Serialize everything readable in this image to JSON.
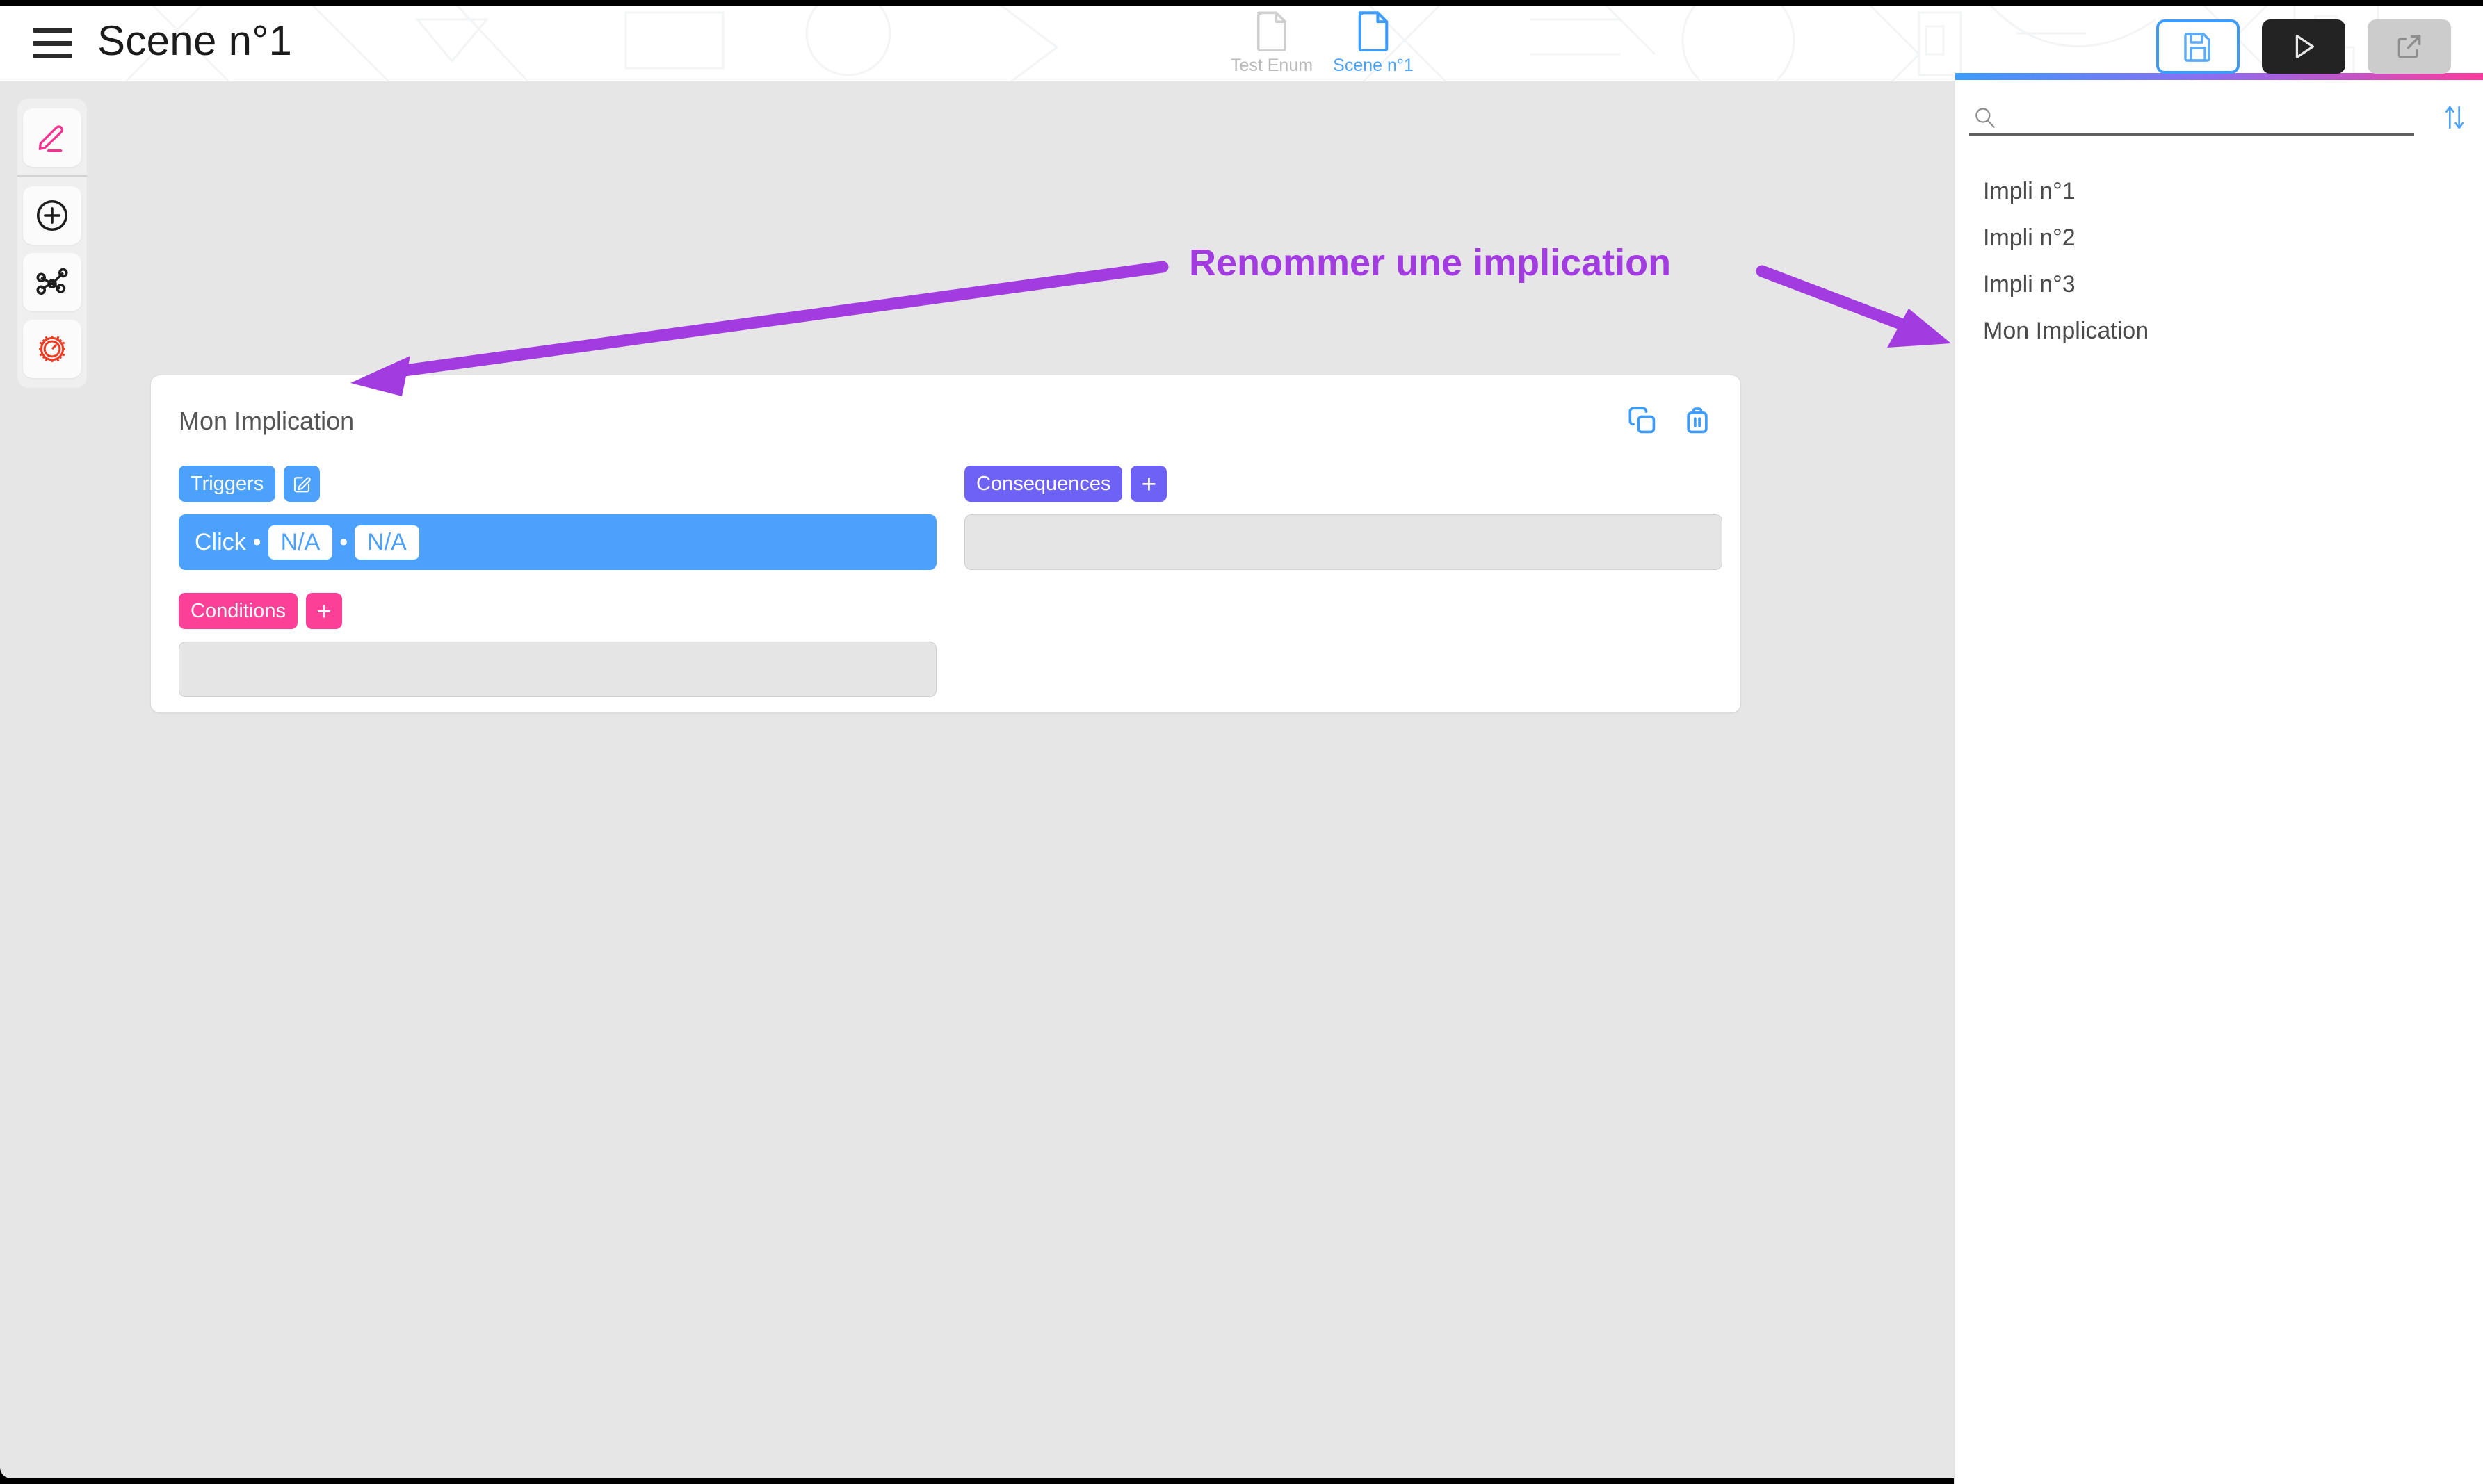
{
  "header": {
    "menu_icon": "hamburger-menu-icon",
    "title": "Scene n°1",
    "tabs": [
      {
        "label": "Test Enum",
        "icon": "document-icon",
        "active": false
      },
      {
        "label": "Scene n°1",
        "icon": "document-icon",
        "active": true
      }
    ],
    "actions": [
      {
        "name": "save-button",
        "icon": "floppy-disk-save-icon",
        "state": "outlined-active"
      },
      {
        "name": "play-button",
        "icon": "play-triangle-icon",
        "state": "dark"
      },
      {
        "name": "export-button",
        "icon": "external-link-icon",
        "state": "disabled"
      }
    ]
  },
  "tool_rail": {
    "tools": [
      {
        "name": "edit-pen-tool",
        "icon": "pen-icon",
        "color": "#f8338f"
      },
      {
        "name": "add-tool",
        "icon": "plus-circle-icon",
        "color": "#1d1d1d"
      },
      {
        "name": "graph-nodes-tool",
        "icon": "node-graph-icon",
        "color": "#1d1d1d"
      },
      {
        "name": "settings-gauge-tool",
        "icon": "gauge-gear-icon",
        "color": "#ef3b22"
      }
    ]
  },
  "card": {
    "title": "Mon Implication",
    "duplicate_icon": "copy-duplicate-icon",
    "delete_icon": "trash-bin-icon",
    "triggers": {
      "label": "Triggers",
      "action_icon": "edit-square-pen-icon",
      "item": {
        "name": "Click",
        "params": [
          "N/A",
          "N/A"
        ],
        "separator": "•"
      }
    },
    "consequences": {
      "label": "Consequences",
      "action_label": "+",
      "item": ""
    },
    "conditions": {
      "label": "Conditions",
      "action_label": "+",
      "item": ""
    }
  },
  "right_panel": {
    "search": {
      "value": "",
      "placeholder": "",
      "icon": "magnifier-search-icon"
    },
    "sort_icon": "sort-updown-arrows-icon",
    "items": [
      {
        "label": "Impli n°1"
      },
      {
        "label": "Impli n°2"
      },
      {
        "label": "Impli n°3"
      },
      {
        "label": "Mon Implication"
      }
    ]
  },
  "annotation": {
    "text": "Renommer une implication",
    "color": "#a33ce0"
  },
  "colors": {
    "trigger_blue": "#4ba1fb",
    "consequence_purple": "#6e62f6",
    "condition_pink": "#fc4098",
    "accent_blue": "#3d9bfc",
    "canvas_gray": "#e6e6e6",
    "annotation_purple": "#a33ce0"
  }
}
